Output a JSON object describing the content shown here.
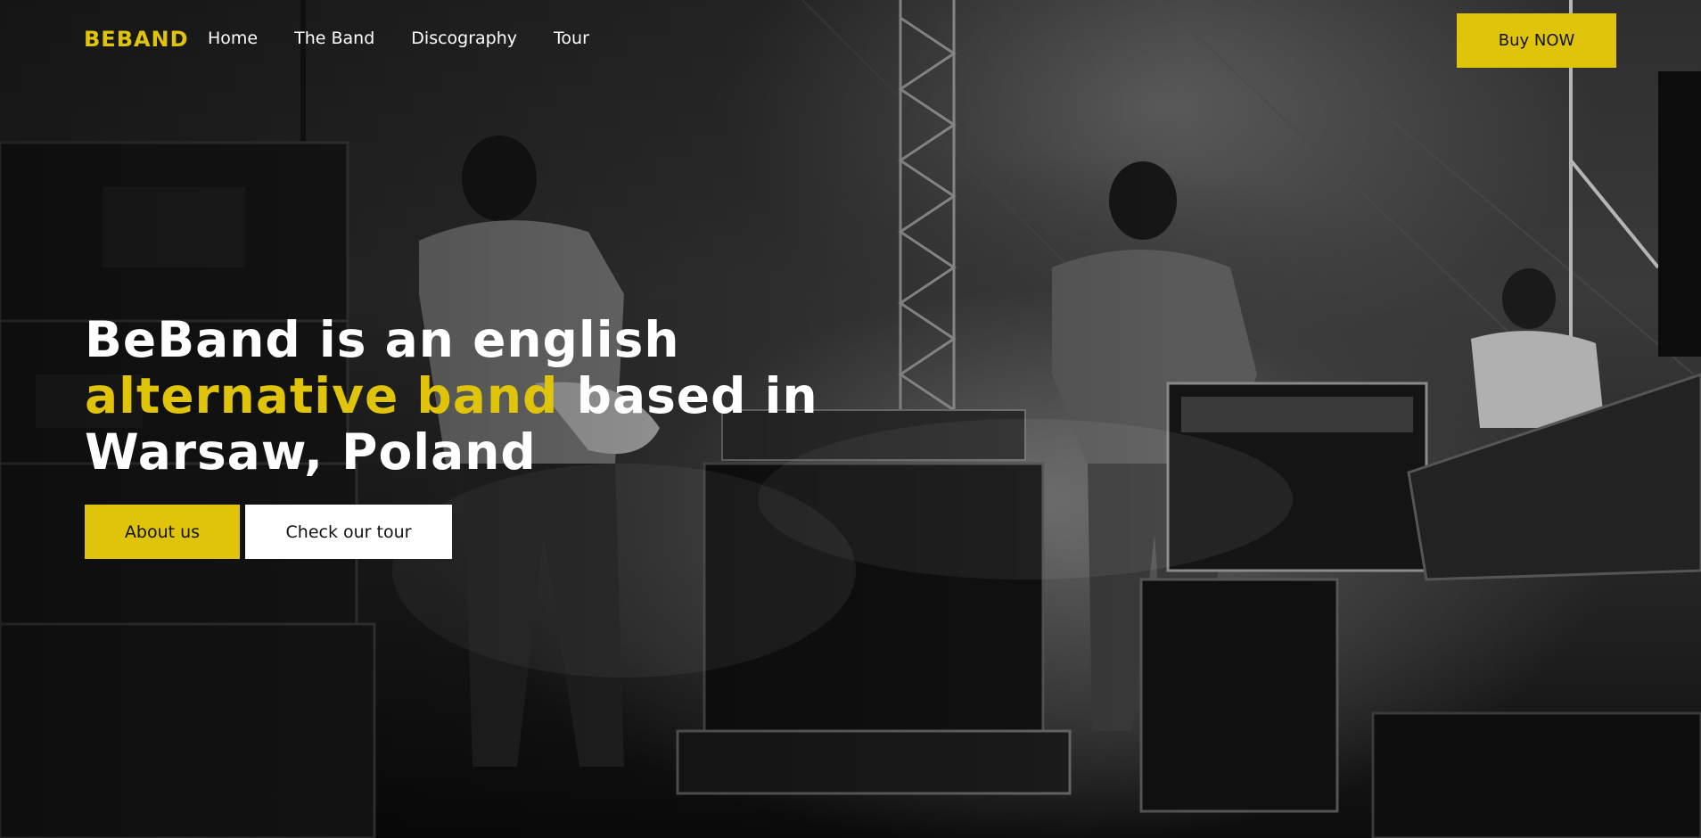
{
  "brand": {
    "logo": "BEBAND",
    "accent_color": "#dfc40a"
  },
  "nav": {
    "links": [
      "Home",
      "The Band",
      "Discography",
      "Tour"
    ],
    "cta_label": "Buy NOW"
  },
  "hero": {
    "headline_part1": "BeBand is an english",
    "headline_highlight": "alternative band",
    "headline_part2": "based in",
    "headline_part3": "Warsaw, Poland",
    "primary_button": "About us",
    "secondary_button": "Check our tour",
    "background_image": "black-and-white photo of a band performing on stage, viewed from behind"
  }
}
